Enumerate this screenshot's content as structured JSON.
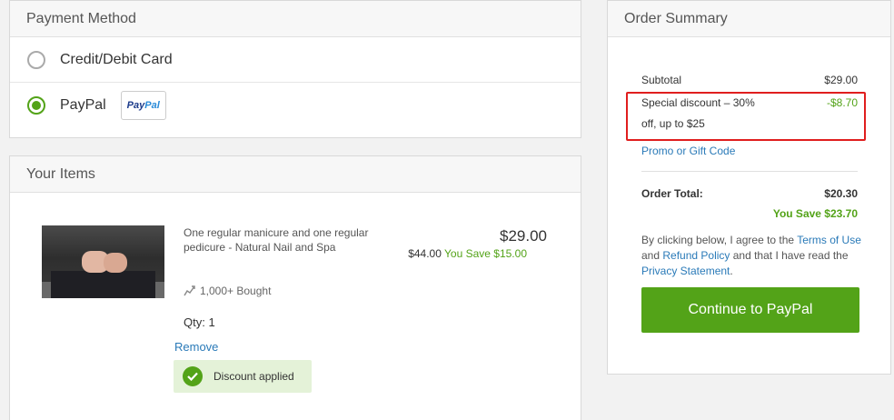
{
  "payment": {
    "title": "Payment Method",
    "options": [
      {
        "label": "Credit/Debit Card",
        "selected": false
      },
      {
        "label": "PayPal",
        "selected": true
      }
    ],
    "paypal_badge_a": "Pay",
    "paypal_badge_b": "Pal"
  },
  "items": {
    "title": "Your Items",
    "item": {
      "name": "One regular manicure and one regular pedicure - Natural Nail and Spa",
      "price": "$29.00",
      "original_price": "$44.00",
      "you_save": "You Save $15.00",
      "bought": "1,000+ Bought",
      "qty": "Qty: 1",
      "remove": "Remove",
      "discount_applied": "Discount applied"
    }
  },
  "summary": {
    "title": "Order Summary",
    "subtotal_label": "Subtotal",
    "subtotal_value": "$29.00",
    "discount_label_1": "Special discount – 30%",
    "discount_label_2": "off, up to $25",
    "discount_value": "-$8.70",
    "promo": "Promo or Gift Code",
    "total_label": "Order Total:",
    "total_value": "$20.30",
    "you_save": "You Save $23.70",
    "legal_1": "By clicking below, I agree to the ",
    "terms": "Terms of Use",
    "legal_2": " and ",
    "refund": "Refund Policy",
    "legal_3": " and that I have read the ",
    "privacy": "Privacy Statement",
    "legal_4": ".",
    "continue": "Continue to PayPal"
  },
  "colors": {
    "accent_green": "#53a318",
    "link_blue": "#2a7ab8",
    "highlight_red": "#e01e1e"
  }
}
